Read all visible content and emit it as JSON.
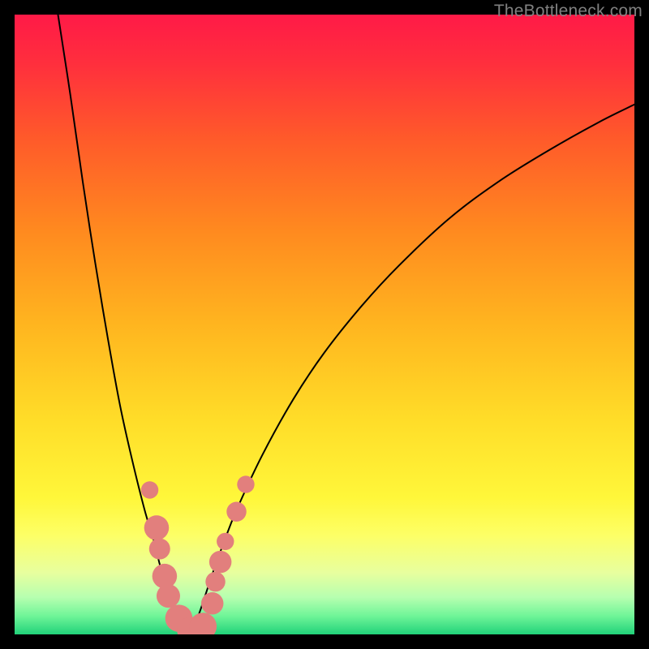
{
  "watermark": "TheBottleneck.com",
  "chart_data": {
    "type": "line",
    "title": "",
    "xlabel": "",
    "ylabel": "",
    "xlim": [
      0,
      100
    ],
    "ylim": [
      0,
      100
    ],
    "gradient_stops": [
      {
        "offset": 0.0,
        "color": "#ff1a47"
      },
      {
        "offset": 0.08,
        "color": "#ff2f3d"
      },
      {
        "offset": 0.2,
        "color": "#ff5a2a"
      },
      {
        "offset": 0.35,
        "color": "#ff8a1f"
      },
      {
        "offset": 0.5,
        "color": "#ffb51f"
      },
      {
        "offset": 0.65,
        "color": "#ffdc28"
      },
      {
        "offset": 0.78,
        "color": "#fff73a"
      },
      {
        "offset": 0.84,
        "color": "#fdff66"
      },
      {
        "offset": 0.9,
        "color": "#e8ff9e"
      },
      {
        "offset": 0.94,
        "color": "#b7ffb0"
      },
      {
        "offset": 0.97,
        "color": "#70f598"
      },
      {
        "offset": 1.0,
        "color": "#21d27a"
      }
    ],
    "series": [
      {
        "name": "left-branch",
        "type": "curve",
        "x": [
          7,
          9,
          11,
          13,
          15,
          17,
          19,
          21,
          22.5,
          23.5,
          24.5,
          25.5,
          27,
          28.5
        ],
        "y": [
          100,
          87,
          73,
          60,
          48,
          37,
          28,
          20,
          15,
          11,
          8,
          5,
          2,
          0
        ]
      },
      {
        "name": "right-branch",
        "type": "curve",
        "x": [
          28.5,
          30,
          32,
          34,
          36,
          40,
          45,
          50,
          56,
          62,
          70,
          78,
          86,
          94,
          100
        ],
        "y": [
          0,
          4,
          10,
          15.5,
          20.5,
          29,
          38,
          45.5,
          53,
          59.5,
          67,
          73,
          78,
          82.5,
          85.5
        ]
      }
    ],
    "markers": {
      "name": "highlighted-points",
      "color": "#e27f7d",
      "points": [
        {
          "x": 21.8,
          "y": 23.3,
          "r": 1.4
        },
        {
          "x": 22.9,
          "y": 17.2,
          "r": 2.0
        },
        {
          "x": 23.4,
          "y": 13.8,
          "r": 1.7
        },
        {
          "x": 24.2,
          "y": 9.4,
          "r": 2.0
        },
        {
          "x": 24.8,
          "y": 6.2,
          "r": 1.9
        },
        {
          "x": 26.5,
          "y": 2.6,
          "r": 2.2
        },
        {
          "x": 28.3,
          "y": 0.7,
          "r": 2.1
        },
        {
          "x": 30.4,
          "y": 1.3,
          "r": 2.2
        },
        {
          "x": 31.9,
          "y": 5.0,
          "r": 1.8
        },
        {
          "x": 32.4,
          "y": 8.5,
          "r": 1.6
        },
        {
          "x": 33.2,
          "y": 11.7,
          "r": 1.8
        },
        {
          "x": 34.0,
          "y": 15.0,
          "r": 1.4
        },
        {
          "x": 35.8,
          "y": 19.8,
          "r": 1.6
        },
        {
          "x": 37.3,
          "y": 24.2,
          "r": 1.4
        }
      ]
    },
    "minimum": {
      "x": 28.5,
      "y": 0
    }
  }
}
